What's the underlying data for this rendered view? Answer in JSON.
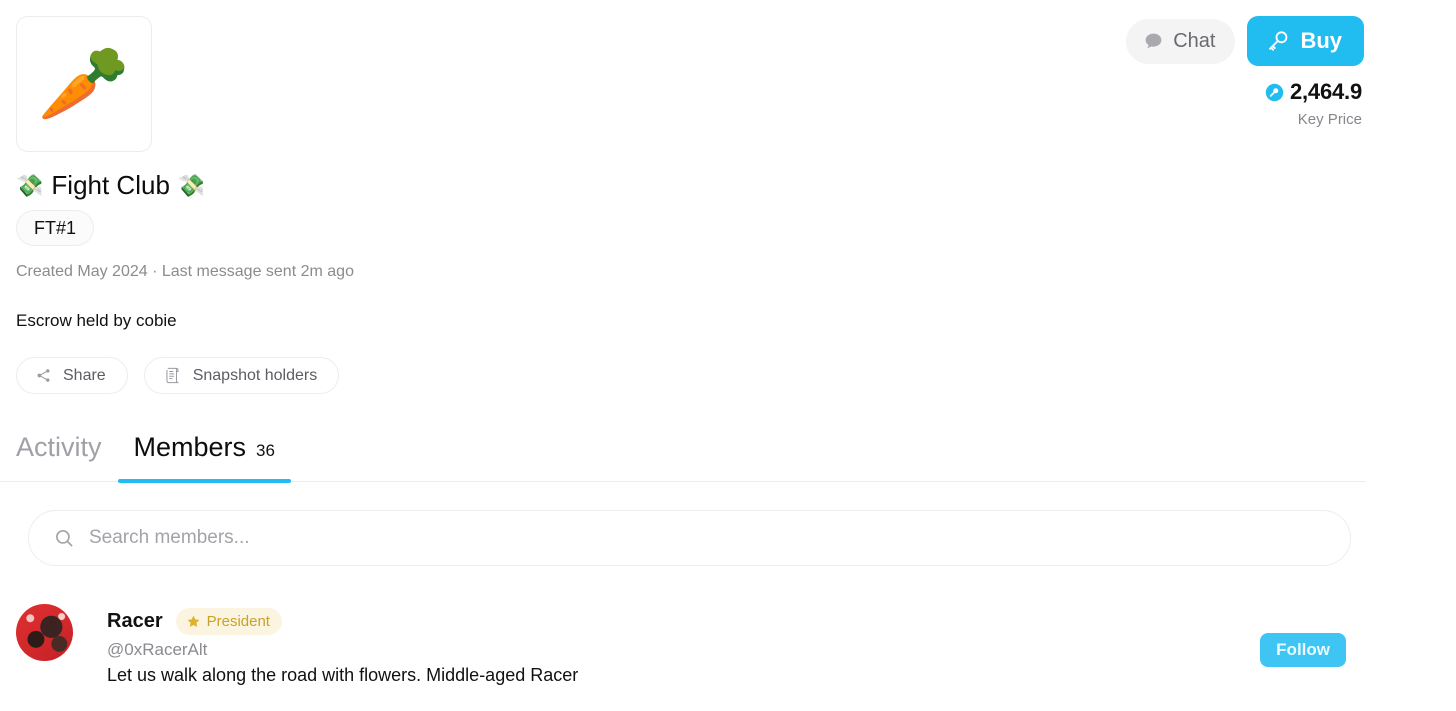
{
  "header": {
    "chat_label": "Chat",
    "chat_icon": "speech-bubble-icon",
    "buy_label": "Buy",
    "buy_icon": "key-icon",
    "key_price_value": "2,464.9",
    "key_price_caption": "Key Price",
    "price_token_icon": "key-token-icon",
    "accent_color": "#21bcf0"
  },
  "group": {
    "thumbnail_emoji": "🥕",
    "thumbnail_alt": "carrot-emoji",
    "title_prefix_emoji": "💸",
    "title_text": "Fight Club",
    "title_suffix_emoji": "💸",
    "ticker_badge": "FT#1",
    "meta": "Created May 2024 · Last message sent 2m ago",
    "escrow": "Escrow held by cobie"
  },
  "pills": [
    {
      "label": "Share",
      "icon": "share-nodes-icon"
    },
    {
      "label": "Snapshot holders",
      "icon": "scroll-document-icon"
    }
  ],
  "tabs": [
    {
      "label": "Activity",
      "count": "",
      "active": false
    },
    {
      "label": "Members",
      "count": "36",
      "active": true
    }
  ],
  "search": {
    "placeholder": "Search members...",
    "value": "",
    "icon": "search-icon"
  },
  "members": [
    {
      "name": "Racer",
      "role_badge": "President",
      "role_icon": "star-icon",
      "handle": "@0xRacerAlt",
      "bio": "Let us walk along the road with flowers. Middle-aged Racer",
      "follow_label": "Follow",
      "avatar_alt": "racer-avatar"
    }
  ]
}
